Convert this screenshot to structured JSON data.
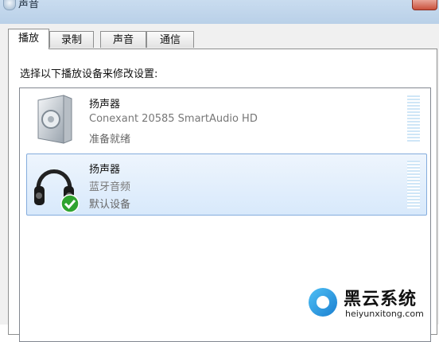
{
  "window": {
    "title": "声音"
  },
  "tabs": [
    {
      "label": "播放",
      "active": true
    },
    {
      "label": "录制",
      "active": false
    },
    {
      "label": "声音",
      "active": false
    },
    {
      "label": "通信",
      "active": false
    }
  ],
  "instruction": "选择以下播放设备来修改设置:",
  "devices": [
    {
      "name": "扬声器",
      "description": "Conexant 20585 SmartAudio HD",
      "status": "准备就绪",
      "icon": "speaker-icon",
      "selected": false,
      "is_default": false
    },
    {
      "name": "扬声器",
      "description": "蓝牙音频",
      "status": "默认设备",
      "icon": "headphones-icon",
      "selected": true,
      "is_default": true
    }
  ],
  "watermark": {
    "title": "黑云系统",
    "url": "heiyunxitong.com"
  },
  "colors": {
    "selection_bg": "#d8e9fb",
    "selection_border": "#84acdd",
    "check_green": "#2fa32f"
  }
}
